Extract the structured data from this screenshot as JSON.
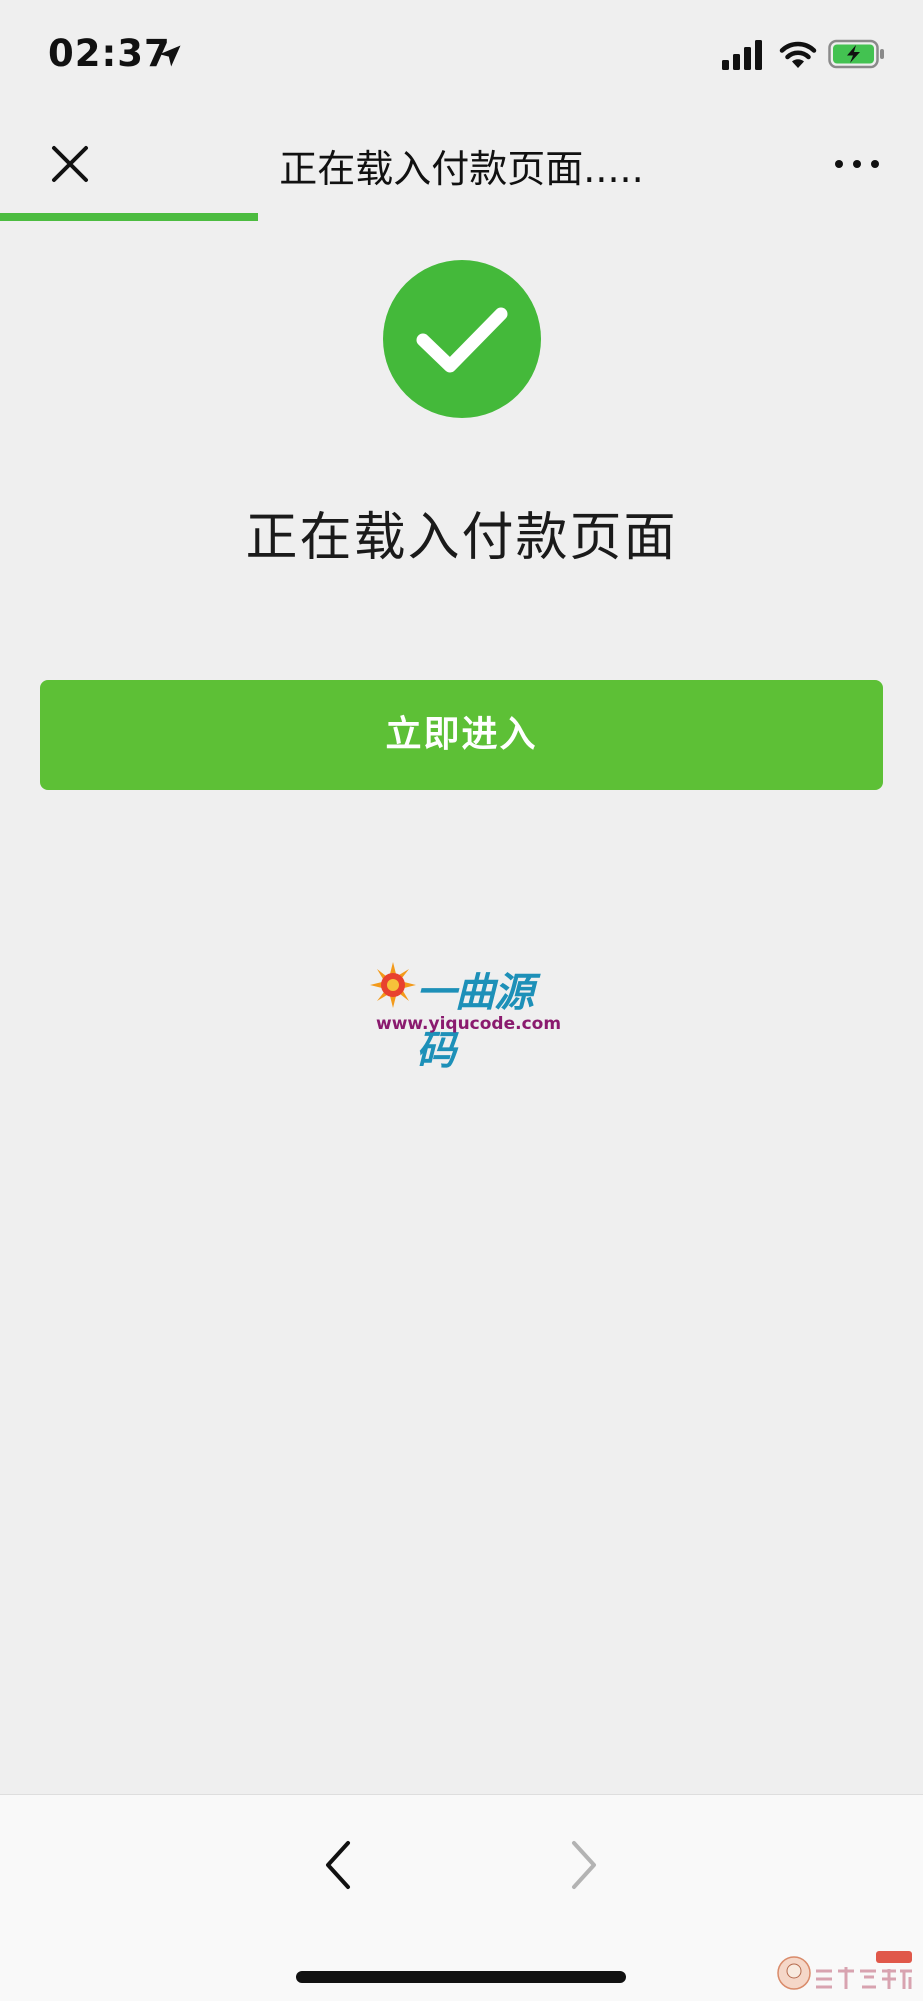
{
  "status_bar": {
    "time": "02:37",
    "icons": [
      "location-arrow-icon",
      "cellular-signal-icon",
      "wifi-icon",
      "battery-charging-icon"
    ]
  },
  "nav": {
    "title": "正在载入付款页面.....",
    "close_icon": "close-icon",
    "more_icon": "more-horizontal-icon",
    "progress_fraction": 0.28,
    "progress_color": "#4cbc40"
  },
  "content": {
    "status_icon": "success-check-icon",
    "status_color": "#44b93a",
    "title": "正在载入付款页面",
    "button_label": "立即进入",
    "button_color": "#5dc036"
  },
  "watermark": {
    "name": "一曲源码",
    "url": "www.yiqucode.com"
  },
  "toolbar": {
    "back_icon": "chevron-left-icon",
    "forward_icon": "chevron-right-icon"
  }
}
